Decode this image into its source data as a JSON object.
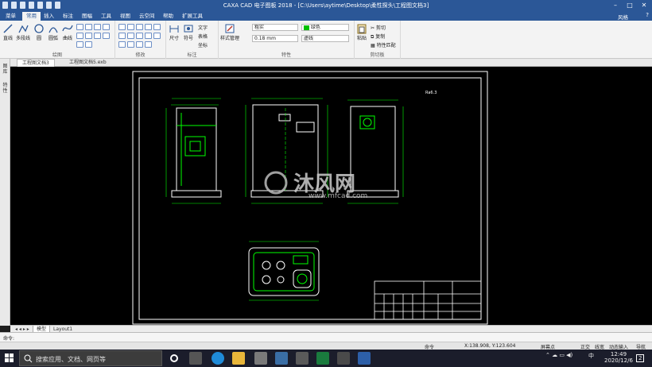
{
  "window": {
    "title": "CAXA CAD 电子图板 2018 - [C:\\Users\\aytime\\Desktop\\柔性探头\\工程图文档3]"
  },
  "ribbon_tabs": [
    {
      "label": "菜单",
      "active": false
    },
    {
      "label": "常用",
      "active": true
    },
    {
      "label": "插入",
      "active": false
    },
    {
      "label": "标注",
      "active": false
    },
    {
      "label": "图幅",
      "active": false
    },
    {
      "label": "工具",
      "active": false
    },
    {
      "label": "视图",
      "active": false
    },
    {
      "label": "云空间",
      "active": false
    },
    {
      "label": "帮助",
      "active": false
    },
    {
      "label": "扩展工具",
      "active": false
    }
  ],
  "user_label": "风格",
  "help_icon": "?",
  "ribbon": {
    "draw": {
      "group_label": "绘图",
      "buttons": [
        "直线",
        "多段线",
        "圆",
        "圆弧",
        "曲线"
      ]
    },
    "modify": {
      "group_label": "修改"
    },
    "annotate": {
      "group_label": "标注",
      "size_label": "尺寸",
      "symbol_label": "符号",
      "text_label": "文字",
      "table_label": "表格",
      "coord_label": "坐标"
    },
    "style": {
      "group_label": "特性",
      "style_manage_label": "样式管理"
    },
    "properties": {
      "layer_value": "粗实",
      "color_value": "绿色",
      "linewidth_value": "0.18 mm",
      "linetype_value": "虚线",
      "color_swatch": "#00c000"
    },
    "clipboard": {
      "group_label": "剪切板",
      "paste_label": "粘贴",
      "cut_label": "剪切",
      "copy_label": "复制",
      "match_label": "特性匹配"
    }
  },
  "document_tabs": [
    {
      "label": "工程图文档3",
      "active": true
    },
    {
      "label": "工程图文档5.exb",
      "active": false
    }
  ],
  "side_panel": [
    "图库",
    "特性"
  ],
  "layout_tabs": [
    {
      "label": "模型",
      "active": true
    },
    {
      "label": "Layout1",
      "active": false
    }
  ],
  "command_prompt": "命令:",
  "status": {
    "mode": "命令",
    "coords": "X:138.908, Y:123.604",
    "snap": "屏幕点",
    "ortho": "正交",
    "linewidth": "线宽",
    "dynamic_input": "动态输入",
    "nav": "导航"
  },
  "drawing": {
    "watermark": "沐风网",
    "watermark_url": "www.mfcad.com",
    "roughness": "Ra6.3"
  },
  "taskbar": {
    "search_placeholder": "搜索应用、文档、网页等",
    "time": "12:49",
    "date": "2020/12/6",
    "ime": "中",
    "notifications": "2"
  }
}
